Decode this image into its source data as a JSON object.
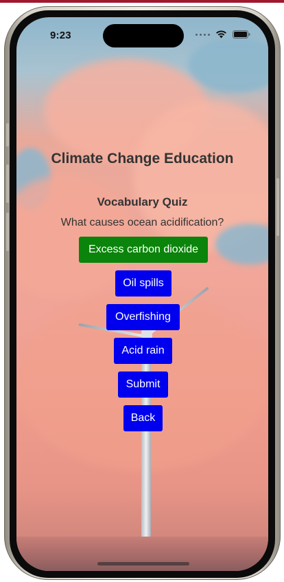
{
  "status_bar": {
    "time": "9:23"
  },
  "app": {
    "title": "Climate Change Education",
    "quiz_title": "Vocabulary Quiz",
    "question": "What causes ocean acidification?",
    "options": [
      {
        "label": "Excess carbon dioxide",
        "selected": true
      },
      {
        "label": "Oil spills",
        "selected": false
      },
      {
        "label": "Overfishing",
        "selected": false
      },
      {
        "label": "Acid rain",
        "selected": false
      }
    ],
    "submit_label": "Submit",
    "back_label": "Back"
  },
  "colors": {
    "option_selected": "#0a840a",
    "option_default": "#0000ee",
    "title_text": "#333333"
  },
  "icons": [
    "cellular-dots-icon",
    "wifi-icon",
    "battery-icon"
  ]
}
